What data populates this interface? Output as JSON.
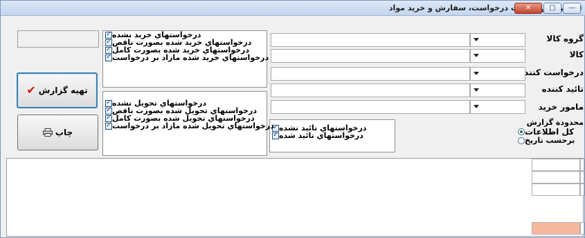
{
  "window": {
    "title": "گزارش وضعيت درخواست، سفارش و خريد مواد",
    "controls": {
      "close": "✕",
      "maximize": "□",
      "minimize": "—"
    }
  },
  "filters": {
    "fields": [
      {
        "label": "گروه کالا",
        "value": ""
      },
      {
        "label": "کالا",
        "value": ""
      },
      {
        "label": "درخواست کننده",
        "value": ""
      },
      {
        "label": "تائيد کننده",
        "value": ""
      },
      {
        "label": "مامور خريد",
        "value": ""
      }
    ]
  },
  "purchase_checks": [
    {
      "label": "درخواستهاي خريد نشده",
      "checked": true
    },
    {
      "label": "درخواستهاي خريد شده بصورت ناقص",
      "checked": true
    },
    {
      "label": "درخواستهاي خريد شده بصورت کامل",
      "checked": true
    },
    {
      "label": "درخواستهاي خريد شده مازاد بر درخواست",
      "checked": true
    }
  ],
  "delivery_checks": [
    {
      "label": "درخواستهاي تحويل نشده",
      "checked": true
    },
    {
      "label": "درخواستهاي تحويل شده بصورت ناقص",
      "checked": true
    },
    {
      "label": "درخواستهاي تحويل شده بصورت کامل",
      "checked": true
    },
    {
      "label": "درخواستهاي تحويل شده مازاد بر درخواست",
      "checked": true
    }
  ],
  "approval_checks": [
    {
      "label": "درخواستهاي تائيد نشده",
      "checked": true
    },
    {
      "label": "درخواستهاي تائيد شده",
      "checked": true
    }
  ],
  "report_scope": {
    "title": "محدودة گزارش",
    "options": [
      {
        "label": "کل اطلاعات",
        "selected": true
      },
      {
        "label": "برحسب تاريخ",
        "selected": false
      }
    ]
  },
  "buttons": {
    "prepare_report": "تهيه گزارش",
    "print": "چاپ"
  },
  "colors": {
    "accent_check": "#cc1111",
    "summary_cell": "#f7b89f",
    "title_bar": "#c3d5ee"
  }
}
